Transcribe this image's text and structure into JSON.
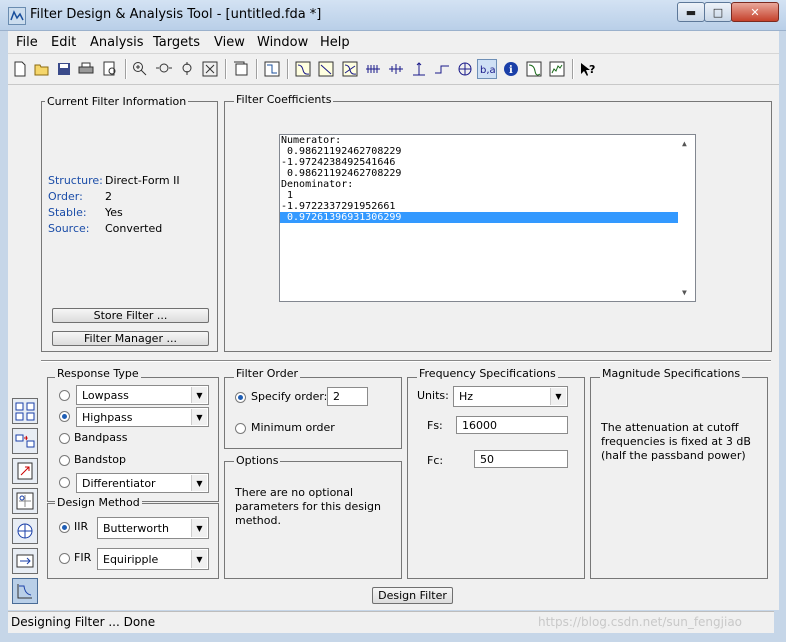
{
  "window": {
    "title": "Filter Design & Analysis Tool  -  [untitled.fda *]",
    "min_label": "▬",
    "max_label": "□",
    "close_label": "✕"
  },
  "menu": [
    "File",
    "Edit",
    "Analysis",
    "Targets",
    "View",
    "Window",
    "Help"
  ],
  "toolbar_icons": [
    "new-icon",
    "open-icon",
    "save-icon",
    "print-icon",
    "print-preview-icon",
    "zoom-in-icon",
    "zoom-x-icon",
    "zoom-fit-icon",
    "full-view-icon",
    "new-figure-icon",
    "magnitude-icon",
    "phase-icon",
    "mag-phase-icon",
    "group-delay-icon",
    "phase-delay-icon",
    "impulse-icon",
    "step-icon",
    "pole-zero-icon",
    "coefficients-icon",
    "info-icon",
    "magnitude-estimate-icon",
    "noise-icon",
    "whats-this-icon"
  ],
  "current_filter": {
    "legend": "Current Filter Information",
    "rows": [
      {
        "label": "Structure:",
        "value": "Direct-Form II"
      },
      {
        "label": "Order:",
        "value": "2"
      },
      {
        "label": "Stable:",
        "value": "Yes"
      },
      {
        "label": "Source:",
        "value": "Converted"
      }
    ],
    "store_label": "Store Filter ...",
    "manager_label": "Filter Manager ..."
  },
  "coefficients": {
    "legend": "Filter Coefficients",
    "lines": [
      "Numerator:",
      " 0.98621192462708229",
      "-1.9724238492541646",
      " 0.98621192462708229",
      "Denominator:",
      " 1",
      "-1.9722337291952661",
      " 0.97261396931306299"
    ],
    "selected_index": 7
  },
  "response_type": {
    "legend": "Response Type",
    "options": [
      {
        "label": "Lowpass",
        "type": "select"
      },
      {
        "label": "Highpass",
        "type": "select",
        "checked": true
      },
      {
        "label": "Bandpass",
        "type": "radio"
      },
      {
        "label": "Bandstop",
        "type": "radio"
      },
      {
        "label": "Differentiator",
        "type": "select"
      }
    ]
  },
  "design_method": {
    "legend": "Design Method",
    "iir_label": "IIR",
    "iir_value": "Butterworth",
    "fir_label": "FIR",
    "fir_value": "Equiripple"
  },
  "filter_order": {
    "legend": "Filter Order",
    "specify_label": "Specify order:",
    "specify_value": "2",
    "minimum_label": "Minimum order"
  },
  "options": {
    "legend": "Options",
    "text": "There are no optional parameters for this design method."
  },
  "frequency": {
    "legend": "Frequency Specifications",
    "units_label": "Units:",
    "units_value": "Hz",
    "fs_label": "Fs:",
    "fs_value": "16000",
    "fc_label": "Fc:",
    "fc_value": "50"
  },
  "magnitude": {
    "legend": "Magnitude Specifications",
    "text": "The attenuation at cutoff frequencies is fixed at 3 dB (half the passband power)"
  },
  "design_button": "Design Filter",
  "status": "Designing Filter ... Done",
  "watermark": "https://blog.csdn.net/sun_fengjiao",
  "side_icons": [
    "transform-filter-icon",
    "convert-structure-icon",
    "import-filter-icon",
    "pole-zero-editor-icon",
    "multirate-icon",
    "realize-model-icon",
    "design-filter-icon"
  ]
}
